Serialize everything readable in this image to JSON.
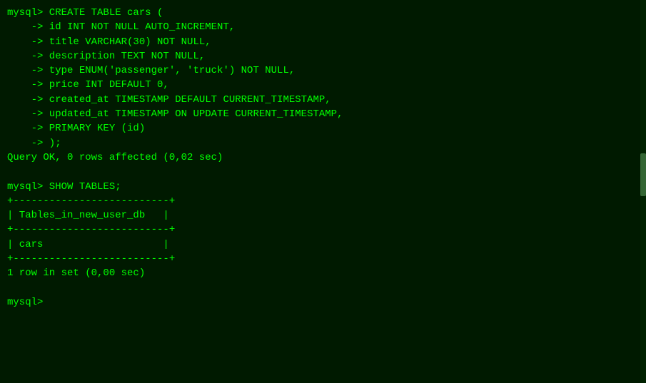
{
  "terminal": {
    "content": [
      "mysql> CREATE TABLE cars (",
      "    -> id INT NOT NULL AUTO_INCREMENT,",
      "    -> title VARCHAR(30) NOT NULL,",
      "    -> description TEXT NOT NULL,",
      "    -> type ENUM('passenger', 'truck') NOT NULL,",
      "    -> price INT DEFAULT 0,",
      "    -> created_at TIMESTAMP DEFAULT CURRENT_TIMESTAMP,",
      "    -> updated_at TIMESTAMP ON UPDATE CURRENT_TIMESTAMP,",
      "    -> PRIMARY KEY (id)",
      "    -> );",
      "Query OK, 0 rows affected (0,02 sec)",
      "",
      "mysql> SHOW TABLES;",
      "+--------------------------+",
      "| Tables_in_new_user_db   |",
      "+--------------------------+",
      "| cars                    |",
      "+--------------------------+",
      "1 row in set (0,00 sec)",
      "",
      "mysql> "
    ]
  }
}
